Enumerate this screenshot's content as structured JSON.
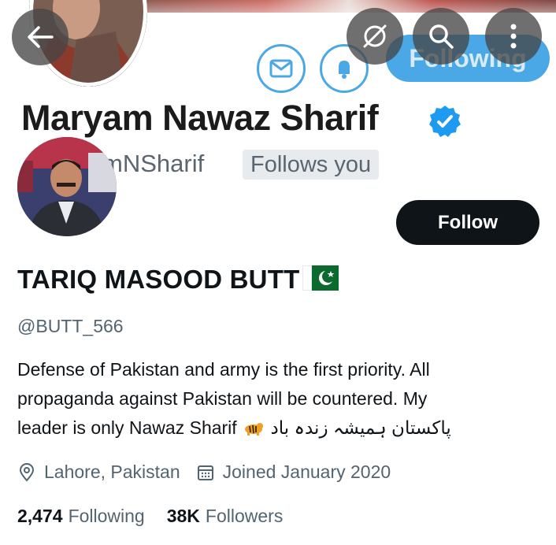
{
  "background_profile": {
    "name": "Maryam Nawaz Sharif",
    "handle_partial": "mNSharif",
    "follows_you_badge": "Follows you",
    "following_button": "Following"
  },
  "overlay": {
    "back_icon": "arrow-left-icon",
    "wand_icon": "magic-wand-icon",
    "search_icon": "search-icon",
    "more_icon": "more-vertical-icon"
  },
  "profile": {
    "display_name": "TARIQ MASOOD BUTT",
    "handle": "@BUTT_566",
    "follow_button": "Follow",
    "bio": {
      "line1": "Defense of Pakistan and army is the first priority. All",
      "line2": "propaganda against Pakistan will be countered. My",
      "line3_start": "leader is only Nawaz Sharif",
      "line3_urdu": "پاکستان ہمیشہ زندہ باد"
    },
    "location": "Lahore, Pakistan",
    "joined": "Joined January 2020",
    "following_count": "2,474",
    "following_label": "Following",
    "followers_count": "38K",
    "followers_label": "Followers"
  },
  "colors": {
    "accent_blue": "#4aa8e6",
    "verified_blue": "#1d9bf0",
    "text_primary": "#0f1419",
    "text_secondary": "#536471",
    "follow_button_bg": "#0f1419"
  }
}
